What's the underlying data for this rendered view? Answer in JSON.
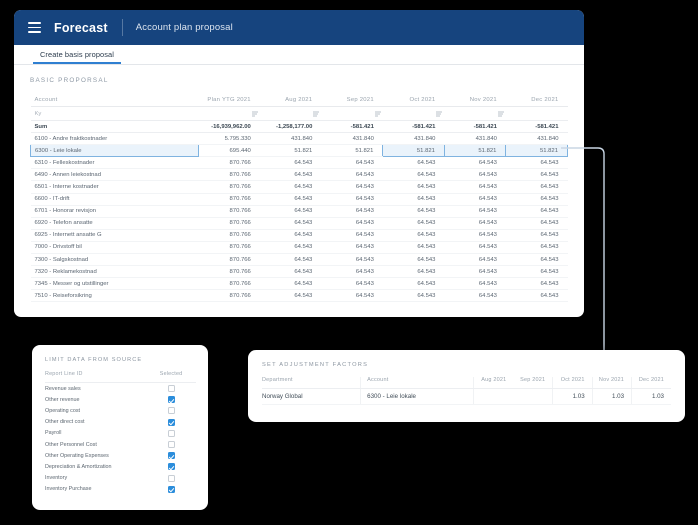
{
  "header": {
    "menu_icon": "hamburger-icon",
    "brand": "Forecast",
    "subtitle": "Account plan proposal"
  },
  "tabs": [
    {
      "label": "Create basis proposal",
      "active": true
    }
  ],
  "main_panel": {
    "caption": "BASIC PROPORSAL",
    "columns": [
      "Account",
      "Plan YTG 2021",
      "Aug 2021",
      "Sep 2021",
      "Oct 2021",
      "Nov 2021",
      "Dec 2021"
    ],
    "filter_row": {
      "account_value": "Ky",
      "filter_icon": "filter-icon"
    },
    "sum_row": {
      "label": "Sum",
      "values": [
        "-16,939,962.00",
        "-1,258,177.00",
        "-581.421",
        "-581.421",
        "-581.421",
        "-581.421"
      ]
    },
    "rows": [
      {
        "account": "6100 - Andre fraktkostnader",
        "values": [
          "5.795.330",
          "431.840",
          "431.840",
          "431.840",
          "431.840",
          "431.840"
        ],
        "selected": false
      },
      {
        "account": "6300 - Leie lokale",
        "values": [
          "695.440",
          "51.821",
          "51.821",
          "51.821",
          "51.821",
          "51.821"
        ],
        "selected": true,
        "selected_cells": [
          3,
          4,
          5
        ]
      },
      {
        "account": "6310 - Felleskostnader",
        "values": [
          "870.766",
          "64.543",
          "64.543",
          "64.543",
          "64.543",
          "64.543"
        ],
        "selected": false
      },
      {
        "account": "6490 - Annen leiekostnad",
        "values": [
          "870.766",
          "64.543",
          "64.543",
          "64.543",
          "64.543",
          "64.543"
        ],
        "selected": false
      },
      {
        "account": "6501 - Interne kostnader",
        "values": [
          "870.766",
          "64.543",
          "64.543",
          "64.543",
          "64.543",
          "64.543"
        ],
        "selected": false
      },
      {
        "account": "6600 - IT-drift",
        "values": [
          "870.766",
          "64.543",
          "64.543",
          "64.543",
          "64.543",
          "64.543"
        ],
        "selected": false
      },
      {
        "account": "6701 - Honorar revisjon",
        "values": [
          "870.766",
          "64.543",
          "64.543",
          "64.543",
          "64.543",
          "64.543"
        ],
        "selected": false
      },
      {
        "account": "6920 - Telefon ansatte",
        "values": [
          "870.766",
          "64.543",
          "64.543",
          "64.543",
          "64.543",
          "64.543"
        ],
        "selected": false
      },
      {
        "account": "6925 - Internett ansatte G",
        "values": [
          "870.766",
          "64.543",
          "64.543",
          "64.543",
          "64.543",
          "64.543"
        ],
        "selected": false
      },
      {
        "account": "7000 - Drivstoff bil",
        "values": [
          "870.766",
          "64.543",
          "64.543",
          "64.543",
          "64.543",
          "64.543"
        ],
        "selected": false
      },
      {
        "account": "7300 - Salgskostnad",
        "values": [
          "870.766",
          "64.543",
          "64.543",
          "64.543",
          "64.543",
          "64.543"
        ],
        "selected": false
      },
      {
        "account": "7320 - Reklamekostnad",
        "values": [
          "870.766",
          "64.543",
          "64.543",
          "64.543",
          "64.543",
          "64.543"
        ],
        "selected": false
      },
      {
        "account": "7345 - Messer og utstillinger",
        "values": [
          "870.766",
          "64.543",
          "64.543",
          "64.543",
          "64.543",
          "64.543"
        ],
        "selected": false
      },
      {
        "account": "7510 - Reiseforsikring",
        "values": [
          "870.766",
          "64.543",
          "64.543",
          "64.543",
          "64.543",
          "64.543"
        ],
        "selected": false
      }
    ]
  },
  "limit_panel": {
    "title": "LIMIT DATA FROM SOURCE",
    "columns": [
      "Report Line ID",
      "Selected"
    ],
    "rows": [
      {
        "label": "Revenue sales",
        "selected": false
      },
      {
        "label": "Other revenue",
        "selected": true
      },
      {
        "label": "Operating cost",
        "selected": false
      },
      {
        "label": "Other direct cost",
        "selected": true
      },
      {
        "label": "Payroll",
        "selected": false
      },
      {
        "label": "Other Personnel Cost",
        "selected": false
      },
      {
        "label": "Other Operating Expenses",
        "selected": true
      },
      {
        "label": "Depreciation & Amortization",
        "selected": true
      },
      {
        "label": "Inventory",
        "selected": false
      },
      {
        "label": "Inventory Purchase",
        "selected": true
      }
    ]
  },
  "adjustment_panel": {
    "title": "SET ADJUSTMENT FACTORS",
    "columns": [
      "Department",
      "Account",
      "Aug 2021",
      "Sep 2021",
      "Oct 2021",
      "Nov 2021",
      "Dec 2021"
    ],
    "rows": [
      {
        "department": "Norway Global",
        "account": "6300 - Leie lokale",
        "aug": "",
        "sep": "",
        "oct": "1.03",
        "nov": "1.03",
        "dec": "1.03"
      }
    ]
  },
  "colors": {
    "header_bg": "#16447e",
    "tab_accent": "#2f7fd1",
    "selection_border": "#7fb3e0",
    "selection_bg": "#eaf3fb",
    "checkbox_on": "#2b8ddb",
    "connector": "#c9d6e4"
  }
}
